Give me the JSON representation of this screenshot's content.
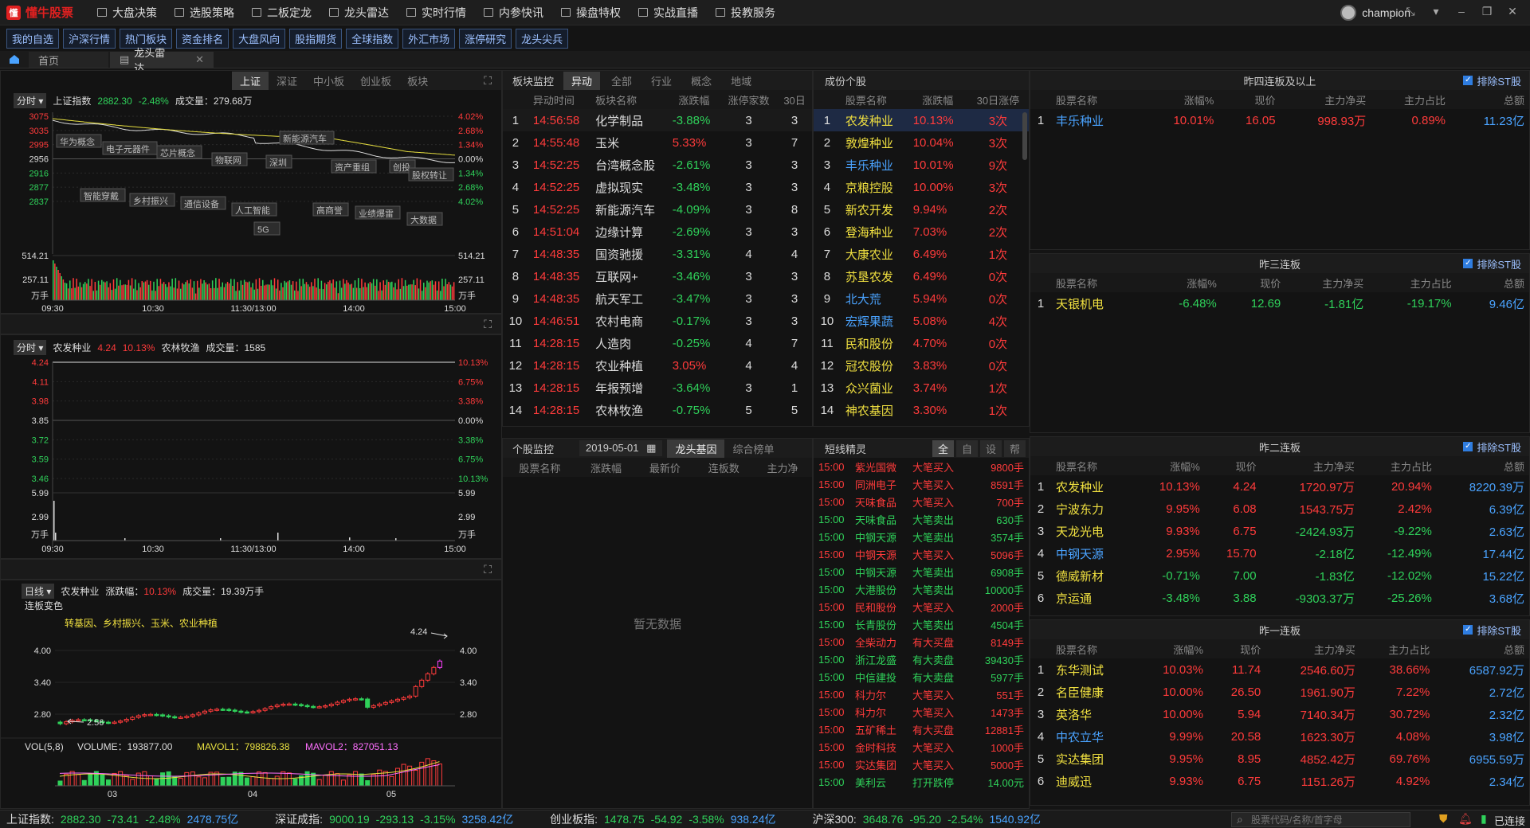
{
  "app": {
    "name": "懂牛股票",
    "user": "champion"
  },
  "menu": [
    {
      "label": "大盘决策"
    },
    {
      "label": "选股策略"
    },
    {
      "label": "二板定龙"
    },
    {
      "label": "龙头雷达"
    },
    {
      "label": "实时行情"
    },
    {
      "label": "内参快讯"
    },
    {
      "label": "操盘特权"
    },
    {
      "label": "实战直播"
    },
    {
      "label": "投教服务"
    }
  ],
  "nav": [
    "我的自选",
    "沪深行情",
    "热门板块",
    "资金排名",
    "大盘风向",
    "股指期货",
    "全球指数",
    "外汇市场",
    "涨停研究",
    "龙头尖兵"
  ],
  "tabs": [
    {
      "label": "首页"
    },
    {
      "label": "龙头雷达"
    }
  ],
  "chart1": {
    "period": "分时",
    "title": "上证指数",
    "price": "2882.30",
    "pct": "-2.48%",
    "vol_label": "成交量：279.68万",
    "tabs": [
      "上证",
      "深证",
      "中小板",
      "创业板",
      "板块"
    ],
    "y_left": [
      "3075",
      "3035",
      "2995",
      "2956",
      "2916",
      "2877",
      "2837"
    ],
    "y_right": [
      "4.02%",
      "2.68%",
      "1.34%",
      "0.00%",
      "1.34%",
      "2.68%",
      "4.02%"
    ],
    "vol_left": [
      "514.21",
      "257.11",
      "万手"
    ],
    "vol_right": [
      "514.21",
      "257.11",
      "万手"
    ],
    "x": [
      "09:30",
      "10:30",
      "11:30/13:00",
      "14:00",
      "15:00"
    ],
    "concepts": [
      "华为概念",
      "电子元器件",
      "芯片概念",
      "物联网",
      "深圳",
      "新能源汽车",
      "资产重组",
      "创投",
      "股权转让",
      "智能穿戴",
      "乡村振兴",
      "通信设备",
      "人工智能",
      "5G",
      "高商誉",
      "业绩爆雷",
      "大数据"
    ]
  },
  "chart2": {
    "period": "分时",
    "title": "农发种业",
    "price": "4.24",
    "pct": "10.13%",
    "sector": "农林牧渔",
    "vol_label": "成交量：1585",
    "y_left": [
      "4.24",
      "4.11",
      "3.98",
      "3.85",
      "3.72",
      "3.59",
      "3.46"
    ],
    "y_right": [
      "10.13%",
      "6.75%",
      "3.38%",
      "0.00%",
      "3.38%",
      "6.75%",
      "10.13%"
    ],
    "vol_left": [
      "5.99",
      "2.99",
      "万手"
    ],
    "vol_right": [
      "5.99",
      "2.99",
      "万手"
    ],
    "x": [
      "09:30",
      "10:30",
      "11:30/13:00",
      "14:00",
      "15:00"
    ]
  },
  "chart3": {
    "period": "日线",
    "title": "农发种业",
    "pct_label": "涨跌幅：",
    "pct": "10.13%",
    "vol_label": "成交量：19.39万手",
    "lianban": "连板变色",
    "tags": "转基因、乡村振兴、玉米、农业种植",
    "y": [
      "4.00",
      "3.40",
      "2.80"
    ],
    "hi": "4.24",
    "lo": "2.56",
    "vol_info": {
      "a": "VOL(5,8)",
      "b": "VOLUME：193877.00",
      "c": "MAVOL1：798826.38",
      "d": "MAVOL2：827051.13"
    },
    "x": [
      "03",
      "04",
      "05"
    ]
  },
  "sector_monitor": {
    "title": "板块监控",
    "tabs": [
      "异动",
      "全部",
      "行业",
      "概念",
      "地域"
    ],
    "cols": [
      "异动时间",
      "板块名称",
      "涨跌幅",
      "涨停家数",
      "30日"
    ],
    "rows": [
      [
        "1",
        "14:56:58",
        "化学制品",
        "-3.88%",
        "3",
        "3"
      ],
      [
        "2",
        "14:55:48",
        "玉米",
        "5.33%",
        "3",
        "7"
      ],
      [
        "3",
        "14:52:25",
        "台湾概念股",
        "-2.61%",
        "3",
        "3"
      ],
      [
        "4",
        "14:52:25",
        "虚拟现实",
        "-3.48%",
        "3",
        "3"
      ],
      [
        "5",
        "14:52:25",
        "新能源汽车",
        "-4.09%",
        "3",
        "8"
      ],
      [
        "6",
        "14:51:04",
        "边缘计算",
        "-2.69%",
        "3",
        "3"
      ],
      [
        "7",
        "14:48:35",
        "国资驰援",
        "-3.31%",
        "4",
        "4"
      ],
      [
        "8",
        "14:48:35",
        "互联网+",
        "-3.46%",
        "3",
        "3"
      ],
      [
        "9",
        "14:48:35",
        "航天军工",
        "-3.47%",
        "3",
        "3"
      ],
      [
        "10",
        "14:46:51",
        "农村电商",
        "-0.17%",
        "3",
        "3"
      ],
      [
        "11",
        "14:28:15",
        "人造肉",
        "-0.25%",
        "4",
        "7"
      ],
      [
        "12",
        "14:28:15",
        "农业种植",
        "3.05%",
        "4",
        "4"
      ],
      [
        "13",
        "14:28:15",
        "年报预增",
        "-3.64%",
        "3",
        "1"
      ],
      [
        "14",
        "14:28:15",
        "农林牧渔",
        "-0.75%",
        "5",
        "5"
      ]
    ]
  },
  "components": {
    "title": "成份个股",
    "cols": [
      "股票名称",
      "涨跌幅",
      "30日涨停"
    ],
    "rows": [
      [
        "1",
        "农发种业",
        "10.13%",
        "3次"
      ],
      [
        "2",
        "敦煌种业",
        "10.04%",
        "3次"
      ],
      [
        "3",
        "丰乐种业",
        "10.01%",
        "9次"
      ],
      [
        "4",
        "京粮控股",
        "10.00%",
        "3次"
      ],
      [
        "5",
        "新农开发",
        "9.94%",
        "2次"
      ],
      [
        "6",
        "登海种业",
        "7.03%",
        "2次"
      ],
      [
        "7",
        "大康农业",
        "6.49%",
        "1次"
      ],
      [
        "8",
        "苏垦农发",
        "6.49%",
        "0次"
      ],
      [
        "9",
        "北大荒",
        "5.94%",
        "0次"
      ],
      [
        "10",
        "宏辉果蔬",
        "5.08%",
        "4次"
      ],
      [
        "11",
        "民和股份",
        "4.70%",
        "0次"
      ],
      [
        "12",
        "冠农股份",
        "3.83%",
        "0次"
      ],
      [
        "13",
        "众兴菌业",
        "3.74%",
        "1次"
      ],
      [
        "14",
        "神农基因",
        "3.30%",
        "1次"
      ]
    ]
  },
  "stock_monitor": {
    "title": "个股监控",
    "date": "2019-05-01",
    "tabs": [
      "龙头基因",
      "综合榜单"
    ],
    "cols": [
      "股票名称",
      "涨跌幅",
      "最新价",
      "连板数",
      "主力净"
    ],
    "empty": "暂无数据"
  },
  "shortline": {
    "title": "短线精灵",
    "tabs": [
      "全",
      "自",
      "设",
      "帮"
    ],
    "rows": [
      [
        "15:00",
        "紫光国微",
        "大笔买入",
        "9800手",
        "r"
      ],
      [
        "15:00",
        "同洲电子",
        "大笔买入",
        "8591手",
        "r"
      ],
      [
        "15:00",
        "天味食品",
        "大笔买入",
        "700手",
        "r"
      ],
      [
        "15:00",
        "天味食品",
        "大笔卖出",
        "630手",
        "g"
      ],
      [
        "15:00",
        "中钢天源",
        "大笔卖出",
        "3574手",
        "g"
      ],
      [
        "15:00",
        "中钢天源",
        "大笔买入",
        "5096手",
        "r"
      ],
      [
        "15:00",
        "中钢天源",
        "大笔卖出",
        "6908手",
        "g"
      ],
      [
        "15:00",
        "大港股份",
        "大笔卖出",
        "10000手",
        "g"
      ],
      [
        "15:00",
        "民和股份",
        "大笔买入",
        "2000手",
        "r"
      ],
      [
        "15:00",
        "长青股份",
        "大笔卖出",
        "4504手",
        "g"
      ],
      [
        "15:00",
        "全柴动力",
        "有大买盘",
        "8149手",
        "r"
      ],
      [
        "15:00",
        "浙江龙盛",
        "有大卖盘",
        "39430手",
        "g"
      ],
      [
        "15:00",
        "中信建投",
        "有大卖盘",
        "5977手",
        "g"
      ],
      [
        "15:00",
        "科力尔",
        "大笔买入",
        "551手",
        "r"
      ],
      [
        "15:00",
        "科力尔",
        "大笔买入",
        "1473手",
        "r"
      ],
      [
        "15:00",
        "五矿稀土",
        "有大买盘",
        "12881手",
        "r"
      ],
      [
        "15:00",
        "金时科技",
        "大笔买入",
        "1000手",
        "r"
      ],
      [
        "15:00",
        "实达集团",
        "大笔买入",
        "5000手",
        "r"
      ],
      [
        "15:00",
        "美利云",
        "打开跌停",
        "14.00元",
        "g"
      ]
    ]
  },
  "lianban_tables": [
    {
      "title": "昨四连板及以上",
      "st": "排除ST股",
      "rows": [
        [
          "1",
          "丰乐种业",
          "10.01%",
          "16.05",
          "998.93万",
          "0.89%",
          "11.23亿"
        ]
      ]
    },
    {
      "title": "昨三连板",
      "st": "排除ST股",
      "rows": [
        [
          "1",
          "天银机电",
          "-6.48%",
          "12.69",
          "-1.81亿",
          "-19.17%",
          "9.46亿"
        ]
      ]
    },
    {
      "title": "昨二连板",
      "st": "排除ST股",
      "rows": [
        [
          "1",
          "农发种业",
          "10.13%",
          "4.24",
          "1720.97万",
          "20.94%",
          "8220.39万"
        ],
        [
          "2",
          "宁波东力",
          "9.95%",
          "6.08",
          "1543.75万",
          "2.42%",
          "6.39亿"
        ],
        [
          "3",
          "天龙光电",
          "9.93%",
          "6.75",
          "-2424.93万",
          "-9.22%",
          "2.63亿"
        ],
        [
          "4",
          "中钢天源",
          "2.95%",
          "15.70",
          "-2.18亿",
          "-12.49%",
          "17.44亿"
        ],
        [
          "5",
          "德威新材",
          "-0.71%",
          "7.00",
          "-1.83亿",
          "-12.02%",
          "15.22亿"
        ],
        [
          "6",
          "京运通",
          "-3.48%",
          "3.88",
          "-9303.37万",
          "-25.26%",
          "3.68亿"
        ]
      ]
    },
    {
      "title": "昨一连板",
      "st": "排除ST股",
      "rows": [
        [
          "1",
          "东华测试",
          "10.03%",
          "11.74",
          "2546.60万",
          "38.66%",
          "6587.92万"
        ],
        [
          "2",
          "名臣健康",
          "10.00%",
          "26.50",
          "1961.90万",
          "7.22%",
          "2.72亿"
        ],
        [
          "3",
          "英洛华",
          "10.00%",
          "5.94",
          "7140.34万",
          "30.72%",
          "2.32亿"
        ],
        [
          "4",
          "中农立华",
          "9.99%",
          "20.58",
          "1623.30万",
          "4.08%",
          "3.98亿"
        ],
        [
          "5",
          "实达集团",
          "9.95%",
          "8.95",
          "4852.42万",
          "69.76%",
          "6955.59万"
        ],
        [
          "6",
          "迪威迅",
          "9.93%",
          "6.75",
          "1151.26万",
          "4.92%",
          "2.34亿"
        ]
      ]
    }
  ],
  "lianban_cols": [
    "股票名称",
    "涨幅%",
    "现价",
    "主力净买",
    "主力占比",
    "总额"
  ],
  "status": [
    {
      "name": "上证指数:",
      "v": "2882.30",
      "d": "-73.41",
      "p": "-2.48%",
      "a": "2478.75亿"
    },
    {
      "name": "深证成指:",
      "v": "9000.19",
      "d": "-293.13",
      "p": "-3.15%",
      "a": "3258.42亿"
    },
    {
      "name": "创业板指:",
      "v": "1478.75",
      "d": "-54.92",
      "p": "-3.58%",
      "a": "938.24亿"
    },
    {
      "name": "沪深300:",
      "v": "3648.76",
      "d": "-95.20",
      "p": "-2.54%",
      "a": "1540.92亿"
    }
  ],
  "search_placeholder": "股票代码/名称/首字母",
  "conn": "已连接"
}
